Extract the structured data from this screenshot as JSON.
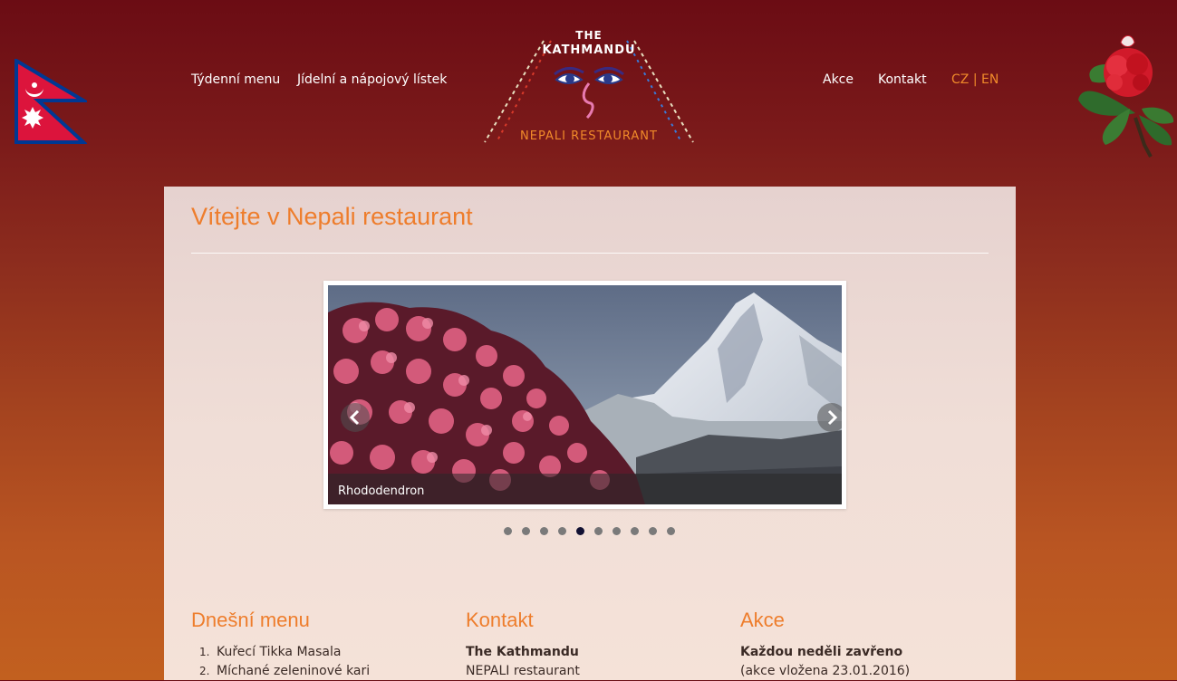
{
  "nav": {
    "left": [
      "Týdenní menu",
      "Jídelní a nápojový lístek"
    ],
    "right": [
      "Akce",
      "Kontakt"
    ],
    "lang_cz": "CZ",
    "lang_sep": "|",
    "lang_en": "EN"
  },
  "logo": {
    "the": "THE",
    "name": "KATHMANDU",
    "sub": "NEPALI RESTAURANT"
  },
  "page_title": "Vítejte v Nepali restaurant",
  "slider": {
    "caption": "Rhododendron",
    "total_slides": 10,
    "active_slide": 5
  },
  "columns": {
    "menu": {
      "heading": "Dnešní menu",
      "items": [
        {
          "num": "1.",
          "label": "Kuřecí Tikka Masala"
        },
        {
          "num": "2.",
          "label": "Míchané zeleninové kari"
        }
      ]
    },
    "contact": {
      "heading": "Kontakt",
      "name": "The Kathmandu",
      "line2": "NEPALI restaurant"
    },
    "events": {
      "heading": "Akce",
      "title": "Každou neděli zavřeno",
      "posted": "(akce vložena 23.01.2016)"
    }
  },
  "colors": {
    "accent": "#ee7d2c",
    "bg_top": "#6b0c14",
    "bg_bottom": "#c2601f",
    "panel": "#f0ded7",
    "dot_active": "#111133",
    "dot": "#7a7a7a"
  }
}
